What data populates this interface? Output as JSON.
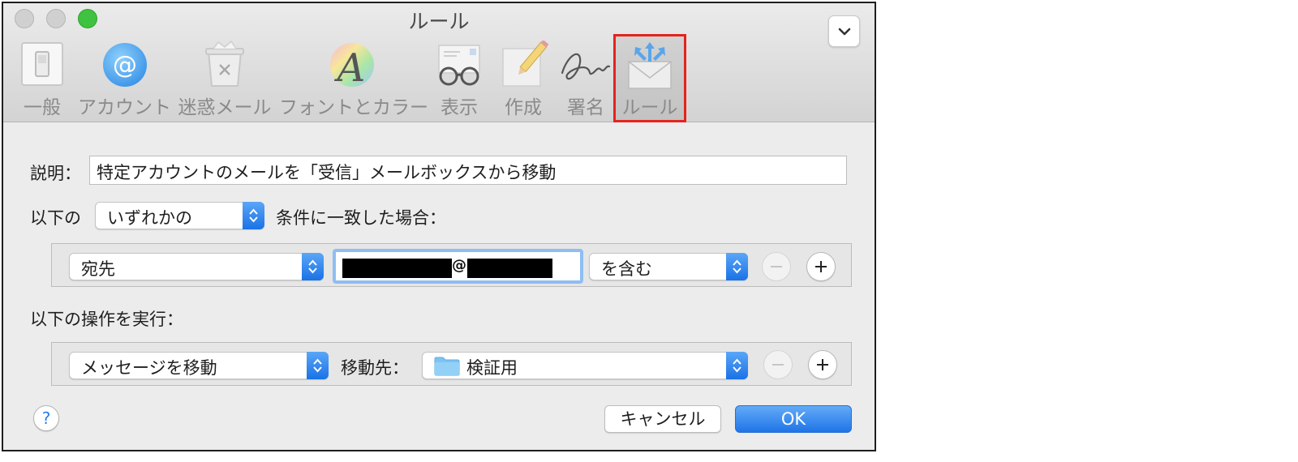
{
  "window": {
    "title": "ルール"
  },
  "toolbar": {
    "items": [
      {
        "label": "一般",
        "icon": "light-switch-icon"
      },
      {
        "label": "アカウント",
        "icon": "at-sign-icon"
      },
      {
        "label": "迷惑メール",
        "icon": "trash-bin-icon"
      },
      {
        "label": "フォントとカラー",
        "icon": "font-color-wheel-icon"
      },
      {
        "label": "表示",
        "icon": "glasses-icon"
      },
      {
        "label": "作成",
        "icon": "pencil-paper-icon"
      },
      {
        "label": "署名",
        "icon": "signature-icon"
      },
      {
        "label": "ルール",
        "icon": "envelope-arrows-icon",
        "selected": true
      }
    ],
    "overflow_icon": "chevron-down-icon",
    "highlight_color": "#e4231e"
  },
  "description": {
    "label": "説明：",
    "value": "特定アカウントのメールを「受信」メールボックスから移動"
  },
  "condition_match": {
    "prefix": "以下の",
    "selected": "いずれかの",
    "suffix": "条件に一致した場合："
  },
  "condition_row": {
    "field": "宛先",
    "value_separator": "@",
    "operator": "を含む",
    "remove_icon": "minus-icon",
    "add_icon": "plus-icon"
  },
  "actions_label": "以下の操作を実行：",
  "action_row": {
    "action": "メッセージを移動",
    "destination_label": "移動先：",
    "destination": "検証用",
    "destination_icon": "folder-icon",
    "remove_icon": "minus-icon",
    "add_icon": "plus-icon"
  },
  "footer": {
    "help_label": "?",
    "cancel_label": "キャンセル",
    "ok_label": "OK"
  },
  "colors": {
    "accent": "#1f74e8",
    "folder": "#7cc3f2"
  }
}
